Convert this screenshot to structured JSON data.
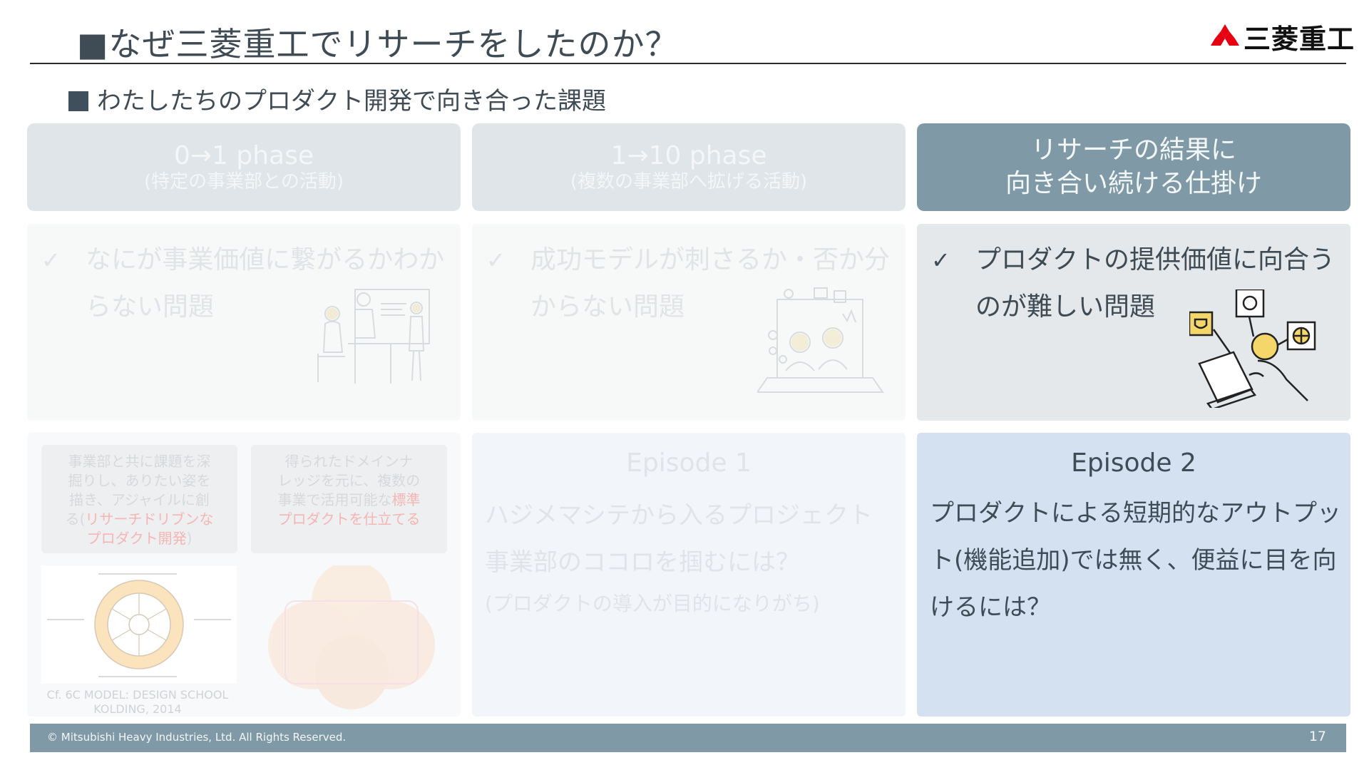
{
  "header": {
    "title": "■なぜ三菱重工でリサーチをしたのか？",
    "logo_text": "三菱重工"
  },
  "subtitle": "わたしたちのプロダクト開発で向き合った課題",
  "phases": [
    {
      "title": "0→1 phase",
      "subtitle": "(特定の事業部との活動)"
    },
    {
      "title": "1→10 phase",
      "subtitle": "(複数の事業部へ拡げる活動)"
    },
    {
      "title_line1": "リサーチの結果に",
      "title_line2": "向き合い続ける仕掛け"
    }
  ],
  "issues": [
    {
      "check": "✓",
      "line1": "なにが事業価値に繋がるかわか",
      "line2": "らない問題",
      "illustration": "team-whiteboard-illustration"
    },
    {
      "check": "✓",
      "line1": "成功モデルが刺さるか・否か分",
      "line2": "からない問題",
      "illustration": "video-call-illustration"
    },
    {
      "check": "✓",
      "line1": "プロダクトの提供価値に向合う",
      "line2": "のが難しい問題",
      "illustration": "developer-laptop-illustration"
    }
  ],
  "phase1_detail": {
    "note_left_line1": "事業部と共に課題を深",
    "note_left_line2": "掘りし、ありたい姿を",
    "note_left_line3": "描き、アジャイルに創",
    "note_left_line4": "る(",
    "note_left_highlight_a": "リサーチドリブンな",
    "note_left_highlight_b": "プロダクト開発",
    "note_left_end": ")",
    "note_right_line1": "得られたドメインナ",
    "note_right_line2": "レッジを元に、複数の",
    "note_right_line3": "事業で活用可能な",
    "note_right_highlight_a": "標準",
    "note_right_highlight_b": "プロダクトを仕立てる",
    "citation_line1": "Cf. 6C MODEL: DESIGN SCHOOL",
    "citation_line2": "KOLDING, 2014"
  },
  "episodes": [
    {
      "title": "Episode 1",
      "line1": "ハジメマシテから入るプロジェクト",
      "line2": "事業部のココロを掴むには？",
      "note": "(プロダクトの導入が目的になりがち)"
    },
    {
      "title": "Episode 2",
      "body": "プロダクトによる短期的なアウトプット(機能追加)では無く、便益に目を向けるには？"
    }
  ],
  "footer": {
    "copyright": "© Mitsubishi Heavy Industries, Ltd.  All Rights Reserved.",
    "page": "17"
  },
  "colors": {
    "accent": "#7f9aa6",
    "episode_active_bg": "#d3e1f1",
    "title_square": "#3f4f5c",
    "logo_red": "#e60012"
  }
}
